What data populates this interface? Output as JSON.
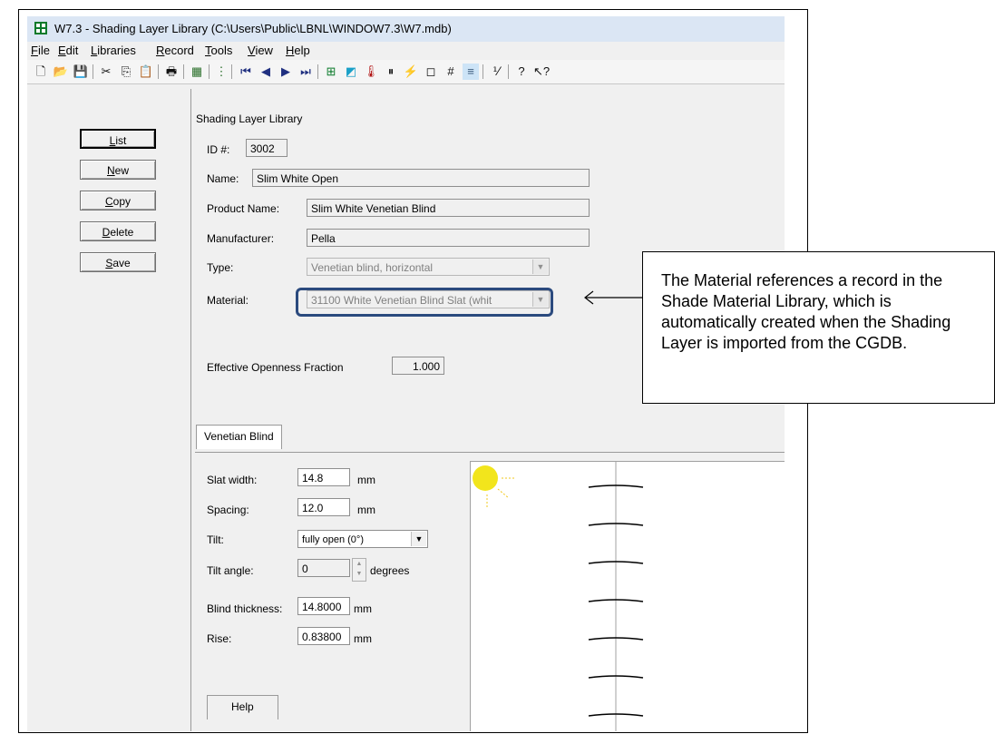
{
  "window": {
    "title": "W7.3 - Shading Layer Library (C:\\Users\\Public\\LBNL\\WINDOW7.3\\W7.mdb)"
  },
  "menu": [
    "File",
    "Edit",
    "Libraries",
    "Record",
    "Tools",
    "View",
    "Help"
  ],
  "toolbar_icons": [
    "new-icon",
    "open-icon",
    "save-icon",
    "cut-icon",
    "copy-icon",
    "paste-icon",
    "print-icon",
    "grid-icon",
    "list-icon",
    "first-record-icon",
    "prev-record-icon",
    "next-record-icon",
    "last-record-icon",
    "window-icon",
    "glass-icon",
    "thermometer-icon",
    "columns-icon",
    "flash-icon",
    "square-icon",
    "hash-icon",
    "blind-icon",
    "formula-icon",
    "help-icon",
    "whats-this-icon"
  ],
  "side_buttons": {
    "list": "List",
    "new": "New",
    "copy": "Copy",
    "delete": "Delete",
    "save": "Save"
  },
  "form": {
    "heading": "Shading Layer Library",
    "id_label": "ID #:",
    "id_value": "3002",
    "name_label": "Name:",
    "name_value": "Slim White Open",
    "product_label": "Product Name:",
    "product_value": "Slim White Venetian Blind",
    "manufacturer_label": "Manufacturer:",
    "manufacturer_value": "Pella",
    "type_label": "Type:",
    "type_value": "Venetian blind, horizontal",
    "material_label": "Material:",
    "material_value": "31100 White Venetian Blind Slat (whit",
    "openness_label": "Effective Openness Fraction",
    "openness_value": "1.000"
  },
  "tab": {
    "label": "Venetian Blind",
    "help": "Help"
  },
  "blind": {
    "slat_width_label": "Slat width:",
    "slat_width_value": "14.8",
    "slat_width_unit": "mm",
    "spacing_label": "Spacing:",
    "spacing_value": "12.0",
    "spacing_unit": "mm",
    "tilt_label": "Tilt:",
    "tilt_value": "fully open (0°)",
    "tilt_angle_label": "Tilt angle:",
    "tilt_angle_value": "0",
    "tilt_angle_unit": "degrees",
    "thickness_label": "Blind thickness:",
    "thickness_value": "14.8000",
    "thickness_unit": "mm",
    "rise_label": "Rise:",
    "rise_value": "0.83800",
    "rise_unit": "mm"
  },
  "callout": {
    "text": "The Material references a record in the Shade Material Library, which is automatically created when the Shading Layer is imported from the CGDB."
  },
  "colors": {
    "sun": "#f2e51c",
    "highlight": "#2b4a7e"
  }
}
